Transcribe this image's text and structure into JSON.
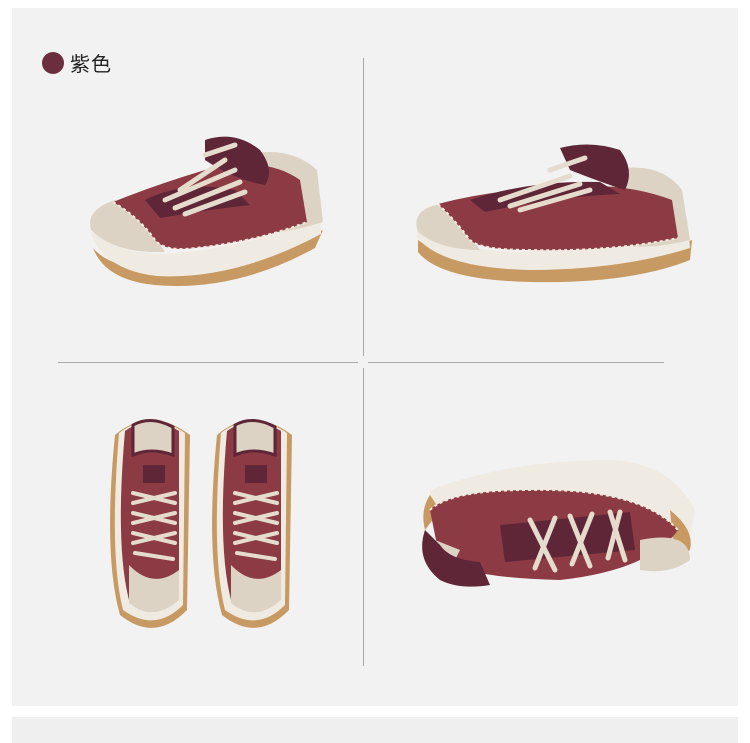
{
  "color_option": {
    "name": "紫色",
    "swatch_color": "#6b2e3e"
  },
  "palette": {
    "suede": "#8c3b45",
    "suede_dark": "#6e2a34",
    "leather": "#5e2636",
    "cream": "#ddd3c4",
    "sole": "#f0ebe2",
    "outsole": "#c79a63",
    "lace": "#e6dccd",
    "stitch": "#f3eadd"
  },
  "views": [
    {
      "icon": "shoe-front-three-quarter-view-icon"
    },
    {
      "icon": "shoe-side-view-icon"
    },
    {
      "icon": "shoe-pair-top-view-icon"
    },
    {
      "icon": "shoe-lying-side-view-icon"
    }
  ]
}
